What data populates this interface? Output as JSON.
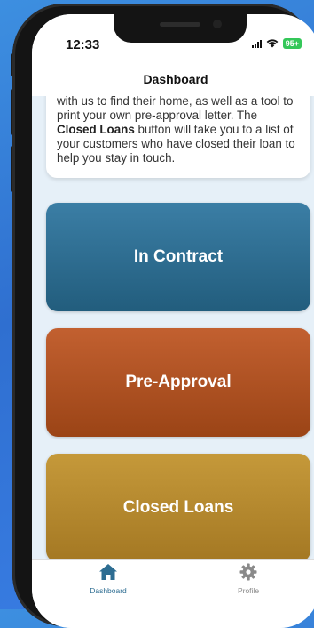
{
  "status_bar": {
    "time": "12:33",
    "battery": "95+",
    "battery_color": "#34c759"
  },
  "header": {
    "title": "Dashboard"
  },
  "info_card": {
    "line_clipped": "with us to find their home, as well as a",
    "text_before": "tool to print your own pre-approval letter. The ",
    "bold": "Closed Loans",
    "text_after": " button will take you to a list of your customers who have closed their loan to help you stay in touch."
  },
  "tiles": [
    {
      "label": "In Contract",
      "color": "#2c6d93"
    },
    {
      "label": "Pre-Approval",
      "color": "#ad5121"
    },
    {
      "label": "Closed Loans",
      "color": "#b68a2f"
    }
  ],
  "tab_bar": {
    "tabs": [
      {
        "label": "Dashboard",
        "icon": "home-icon",
        "active": true,
        "color": "#2d6d92"
      },
      {
        "label": "Profile",
        "icon": "gear-icon",
        "active": false,
        "color": "#8a8a8a"
      }
    ]
  },
  "colors": {
    "background": "#3a7fe0",
    "screen": "#e6f0f8"
  }
}
